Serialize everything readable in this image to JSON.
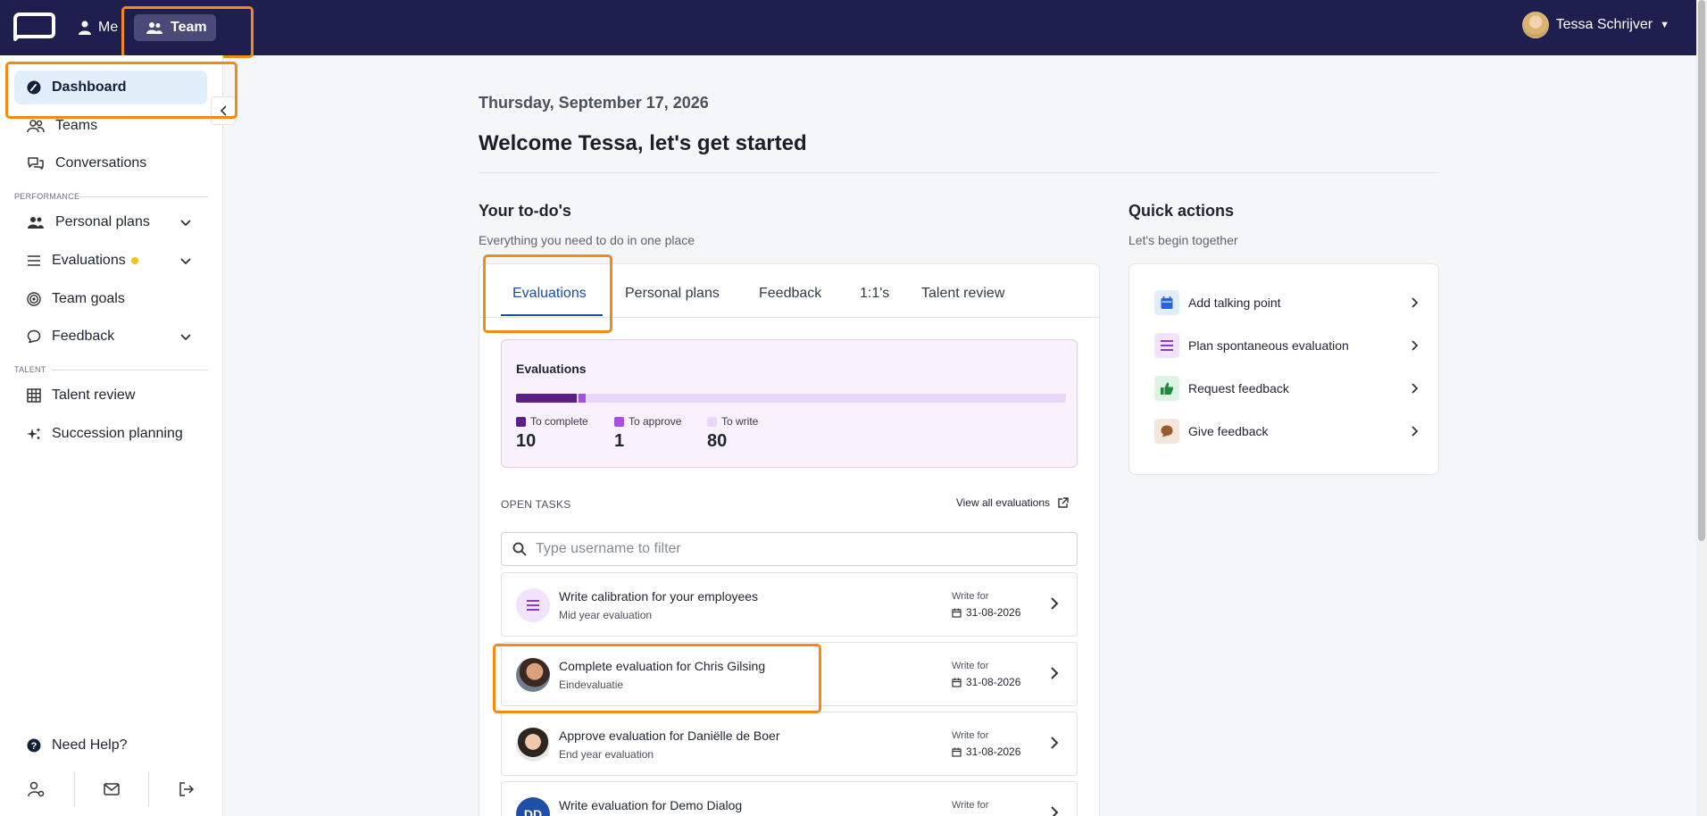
{
  "topbar": {
    "me_label": "Me",
    "team_label": "Team",
    "user_name": "Tessa Schrijver"
  },
  "sidebar": {
    "items": [
      {
        "label": "Dashboard"
      },
      {
        "label": "Teams"
      },
      {
        "label": "Conversations"
      },
      {
        "label": "Personal plans"
      },
      {
        "label": "Evaluations"
      },
      {
        "label": "Team goals"
      },
      {
        "label": "Feedback"
      },
      {
        "label": "Talent review"
      },
      {
        "label": "Succession planning"
      }
    ],
    "section_performance": "PERFORMANCE",
    "section_talent": "TALENT",
    "help_label": "Need Help?"
  },
  "main": {
    "date": "Thursday, September 17, 2026",
    "welcome": "Welcome Tessa, let's get started",
    "todo_title": "Your to-do's",
    "todo_subtitle": "Everything you need to do in one place",
    "tabs": [
      {
        "label": "Evaluations"
      },
      {
        "label": "Personal plans"
      },
      {
        "label": "Feedback"
      },
      {
        "label": "1:1's"
      },
      {
        "label": "Talent review"
      }
    ],
    "eval_summary": {
      "title": "Evaluations",
      "stats": [
        {
          "label": "To complete",
          "value": "10",
          "color": "#5b1f86"
        },
        {
          "label": "To approve",
          "value": "1",
          "color": "#a552e3"
        },
        {
          "label": "To write",
          "value": "80",
          "color": "#e9d7f8"
        }
      ]
    },
    "open_tasks_label": "OPEN TASKS",
    "view_all_label": "View all evaluations",
    "filter_placeholder": "Type username to filter",
    "tasks": [
      {
        "title": "Write calibration for your employees",
        "subtitle": "Mid year evaluation",
        "write_for": "Write for",
        "date": "31-08-2026",
        "icon": "list-icon"
      },
      {
        "title": "Complete evaluation for Chris Gilsing",
        "subtitle": "Eindevaluatie",
        "write_for": "Write for",
        "date": "31-08-2026",
        "icon": "avatar"
      },
      {
        "title": "Approve evaluation for Daniëlle de Boer",
        "subtitle": "End year evaluation",
        "write_for": "Write for",
        "date": "31-08-2026",
        "icon": "avatar"
      },
      {
        "title": "Write evaluation for Demo Dialog",
        "subtitle": "",
        "write_for": "Write for",
        "date": "",
        "icon": "initials",
        "initials": "DD"
      }
    ]
  },
  "quick_actions": {
    "title": "Quick actions",
    "subtitle": "Let's begin together",
    "items": [
      {
        "label": "Add talking point",
        "icon": "calendar-icon",
        "color": "#2563d9"
      },
      {
        "label": "Plan spontaneous evaluation",
        "icon": "list-icon",
        "color": "#8a3fc9"
      },
      {
        "label": "Request feedback",
        "icon": "thumbs-up-icon",
        "color": "#1f8a3a"
      },
      {
        "label": "Give feedback",
        "icon": "chat-bubble-icon",
        "color": "#9a5a2c"
      }
    ]
  },
  "colors": {
    "topbar": "#1e1e4f",
    "highlight": "#f28a15",
    "active_tab": "#1a4f9e"
  }
}
